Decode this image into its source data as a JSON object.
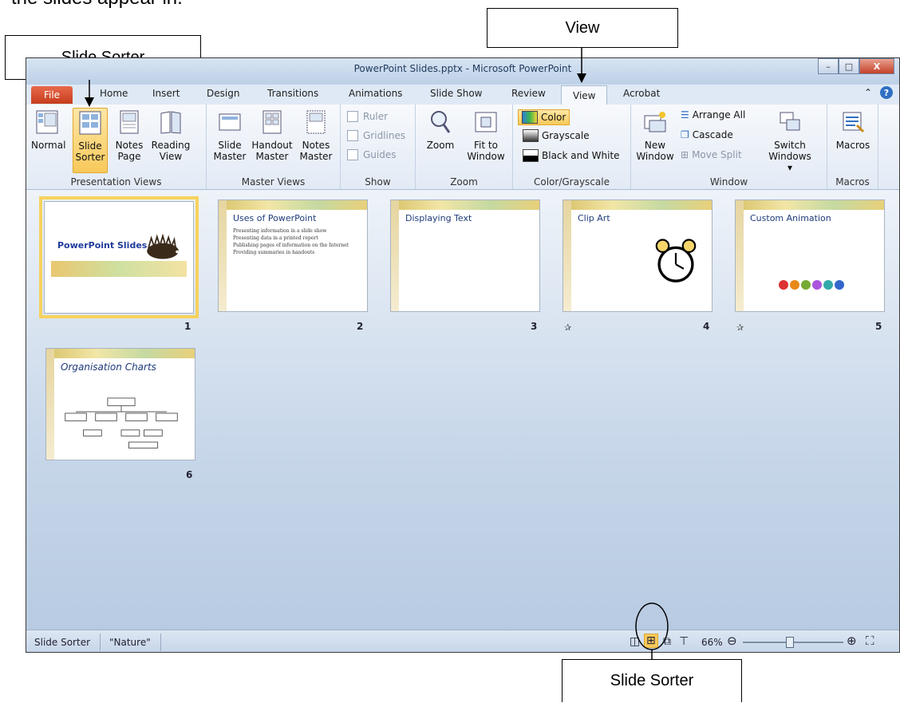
{
  "document": {
    "intro_fragment": "the slides appear in."
  },
  "callouts": {
    "slide_sorter_top": "Slide Sorter",
    "view": "View",
    "slide_sorter_bottom": "Slide Sorter"
  },
  "window": {
    "title": "PowerPoint Slides.pptx - Microsoft PowerPoint",
    "minimize": "–",
    "maximize": "□",
    "close": "X"
  },
  "tabs": [
    "File",
    "Home",
    "Insert",
    "Design",
    "Transitions",
    "Animations",
    "Slide Show",
    "Review",
    "View",
    "Acrobat"
  ],
  "ribbon": {
    "presentation_views": {
      "label": "Presentation Views",
      "normal": "Normal",
      "slide_sorter": "Slide\nSorter",
      "notes_page": "Notes\nPage",
      "reading_view": "Reading\nView"
    },
    "master_views": {
      "label": "Master Views",
      "slide_master": "Slide\nMaster",
      "handout_master": "Handout\nMaster",
      "notes_master": "Notes\nMaster"
    },
    "show": {
      "label": "Show",
      "ruler": "Ruler",
      "gridlines": "Gridlines",
      "guides": "Guides"
    },
    "zoom": {
      "label": "Zoom",
      "zoom": "Zoom",
      "fit_to_window": "Fit to\nWindow"
    },
    "color": {
      "label": "Color/Grayscale",
      "color": "Color",
      "grayscale": "Grayscale",
      "black_white": "Black and White"
    },
    "window": {
      "label": "Window",
      "new_window": "New\nWindow",
      "arrange_all": "Arrange All",
      "cascade": "Cascade",
      "move_split": "Move Split",
      "switch_windows": "Switch\nWindows ▾"
    },
    "macros": {
      "label": "Macros",
      "macros": "Macros"
    }
  },
  "slides": [
    {
      "num": "1",
      "title": "PowerPoint Slides",
      "bullets": []
    },
    {
      "num": "2",
      "title": "Uses of PowerPoint",
      "bullets": [
        "Presenting information in a slide show",
        "Presenting data in a printed report",
        "Publishing pages of information on the Internet",
        "Providing summaries in handouts"
      ]
    },
    {
      "num": "3",
      "title": "Displaying Text",
      "bullets": []
    },
    {
      "num": "4",
      "title": "Clip Art",
      "bullets": []
    },
    {
      "num": "5",
      "title": "Custom Animation",
      "bullets": []
    },
    {
      "num": "6",
      "title": "Organisation Charts",
      "bullets": []
    }
  ],
  "status": {
    "view": "Slide Sorter",
    "theme": "\"Nature\"",
    "zoom": "66%"
  }
}
